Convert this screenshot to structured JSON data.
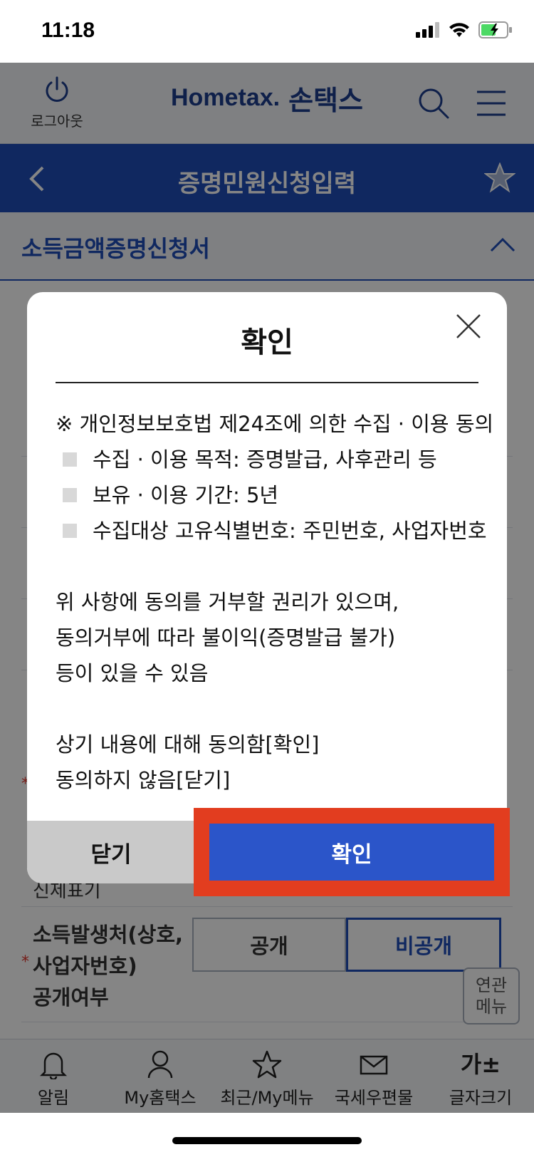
{
  "status_bar": {
    "time": "11:18"
  },
  "header": {
    "logout_label": "로그아웃",
    "logo_text": "Hometax.",
    "logo_korean": "손택스"
  },
  "title_bar": {
    "title": "증명민원신청입력"
  },
  "section": {
    "title": "소득금액증명신청서"
  },
  "form": {
    "partial_label": "신제표기",
    "disclosure_field_label_lines": [
      "소득발생처(상호,",
      "사업자번호)",
      "공개여부"
    ],
    "disclosure_options": [
      "공개",
      "비공개"
    ],
    "disclosure_selected": "비공개"
  },
  "related_menu": {
    "line1": "연관",
    "line2": "메뉴"
  },
  "modal": {
    "title": "확인",
    "consent_heading": "※ 개인정보보호법 제24조에 의한 수집 · 이용 동의",
    "bullets": [
      "수집 · 이용 목적: 증명발급, 사후관리 등",
      "보유 · 이용 기간: 5년",
      "수집대상 고유식별번호: 주민번호, 사업자번호"
    ],
    "notice_lines": [
      "위 사항에 동의를 거부할 권리가 있으며,",
      "동의거부에 따라 불이익(증명발급 불가)",
      "등이 있을 수 있음"
    ],
    "instruction_lines": [
      "상기 내용에 대해 동의함[확인]",
      "동의하지 않음[닫기]"
    ],
    "close_button": "닫기",
    "confirm_button": "확인"
  },
  "bottom_nav": {
    "items": [
      {
        "label": "알림",
        "icon": "bell-icon"
      },
      {
        "label": "My홈택스",
        "icon": "person-icon"
      },
      {
        "label": "최근/My메뉴",
        "icon": "star-icon"
      },
      {
        "label": "국세우편물",
        "icon": "envelope-icon"
      },
      {
        "label": "글자크기",
        "icon": "font-size-icon",
        "glyph": "가±"
      }
    ]
  },
  "colors": {
    "primary_blue": "#1f4db8",
    "confirm_blue": "#2b55c9",
    "highlight_red": "#e23d1f",
    "close_gray": "#c9c9c9"
  }
}
